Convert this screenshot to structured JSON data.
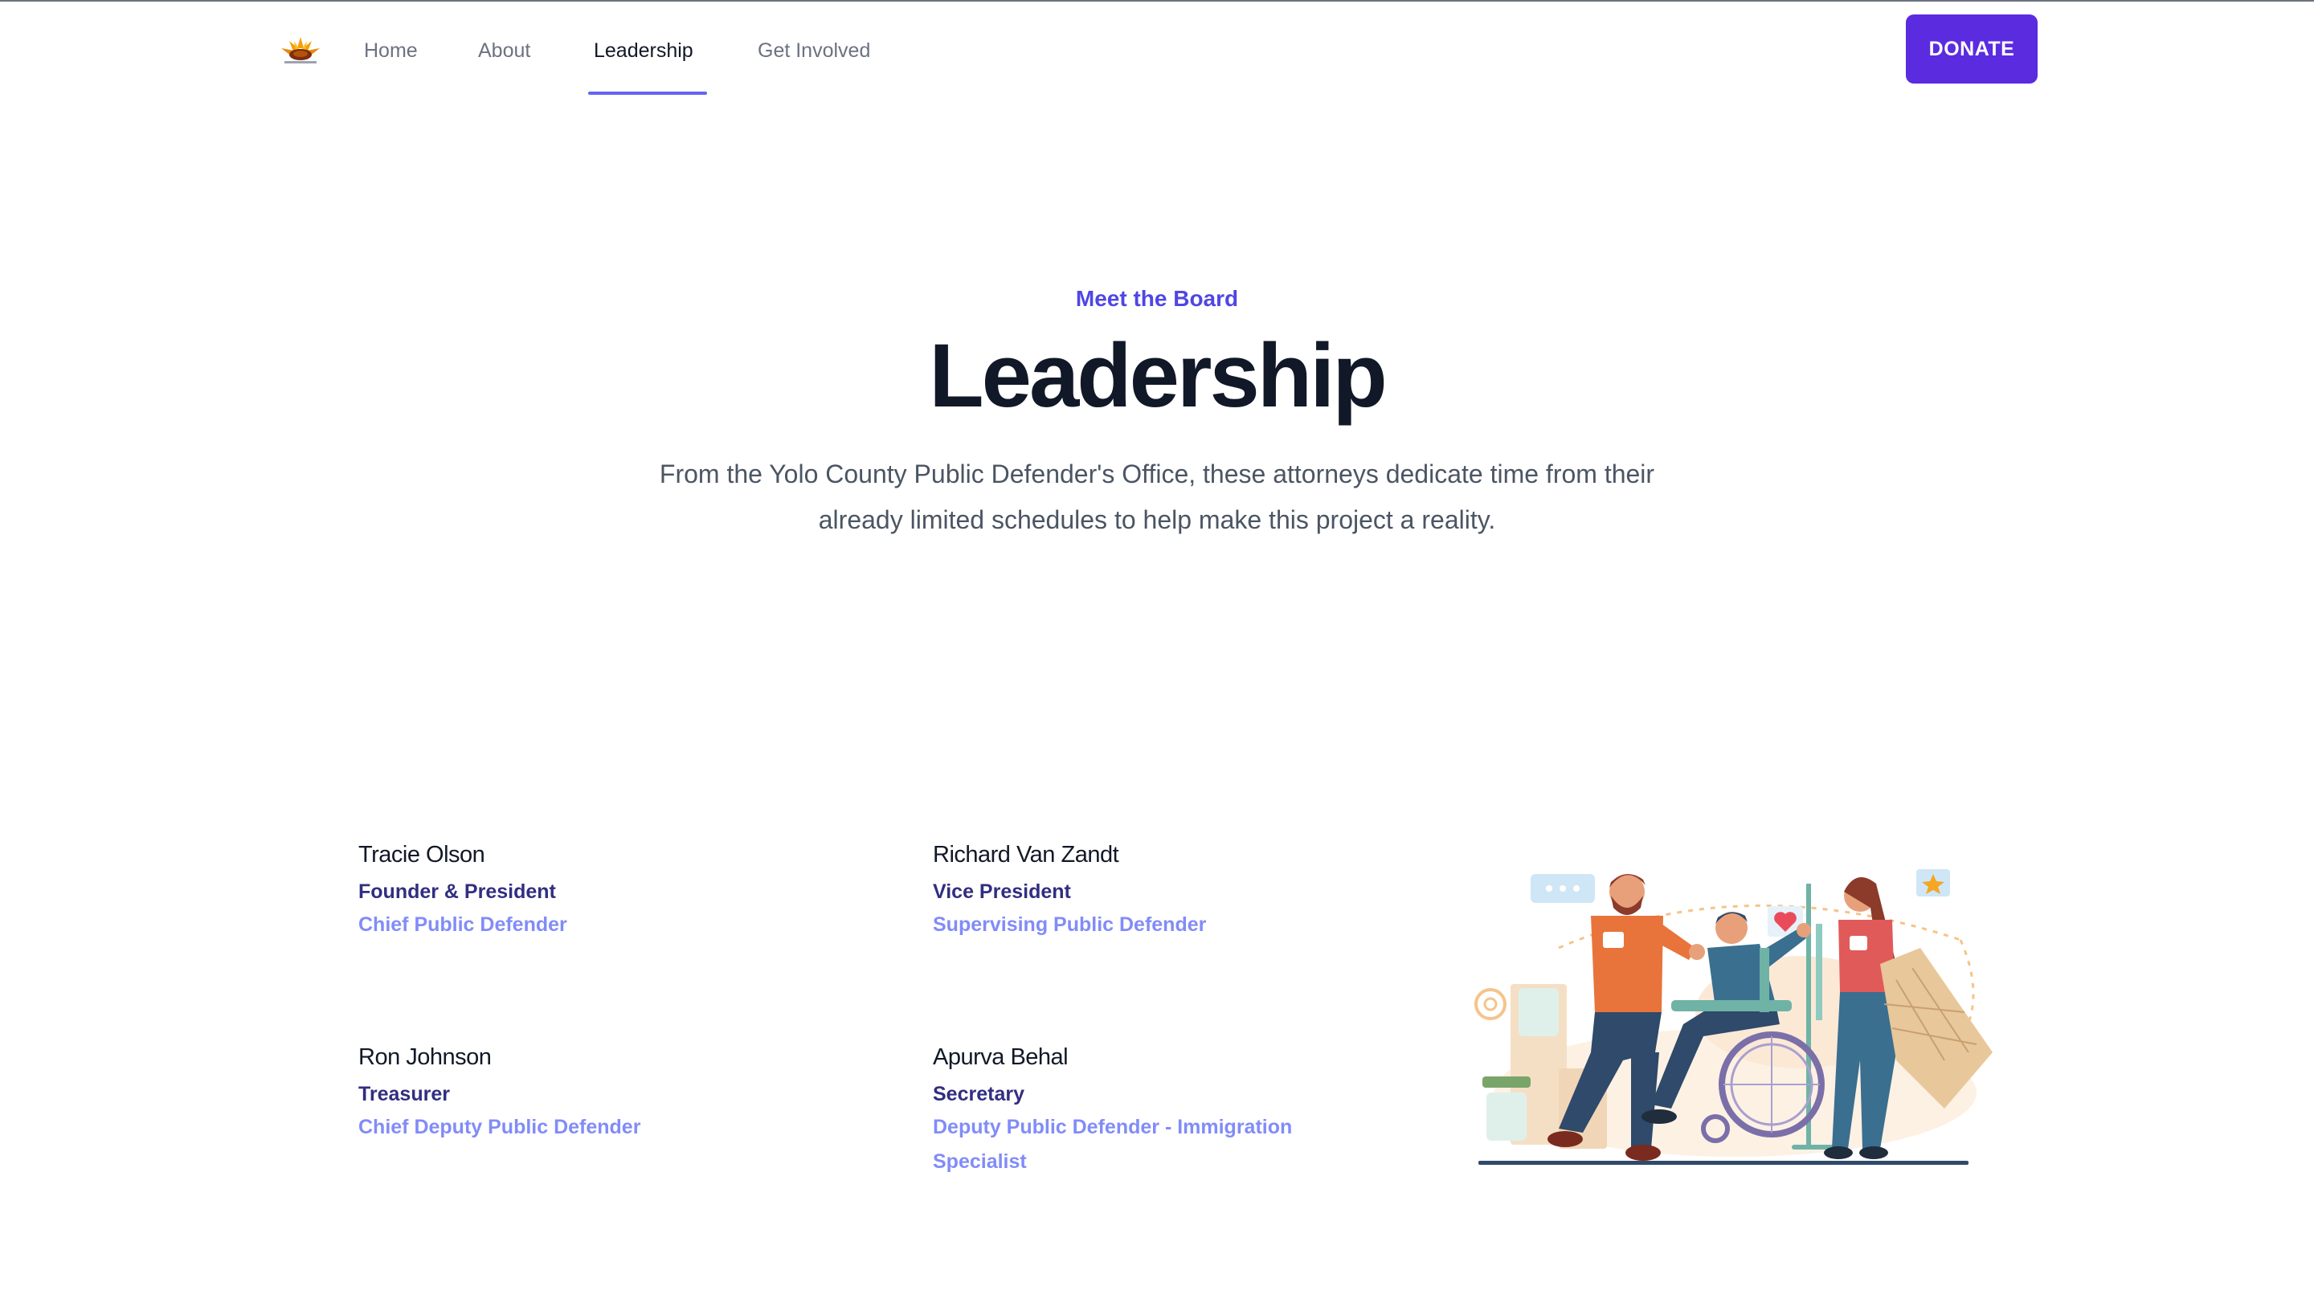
{
  "nav": {
    "links": [
      {
        "label": "Home"
      },
      {
        "label": "About"
      },
      {
        "label": "Leadership"
      },
      {
        "label": "Get Involved"
      }
    ],
    "active": "Leadership",
    "donate_label": "DONATE"
  },
  "hero": {
    "eyebrow": "Meet the Board",
    "title": "Leadership",
    "description": "From the Yolo County Public Defender's Office, these attorneys dedicate time from their already limited schedules to help make this project a reality."
  },
  "board": [
    {
      "name": "Tracie Olson",
      "role": "Founder & President",
      "title": "Chief Public Defender"
    },
    {
      "name": "Richard Van Zandt",
      "role": "Vice President",
      "title": "Supervising Public Defender"
    },
    {
      "name": "Ron Johnson",
      "role": "Treasurer",
      "title": "Chief Deputy Public Defender"
    },
    {
      "name": "Apurva Behal",
      "role": "Secretary",
      "title": "Deputy Public Defender - Immigration Specialist"
    }
  ],
  "colors": {
    "accent": "#4f46e5",
    "donate": "#5b2be0",
    "role": "#312e81",
    "title": "#818cf8"
  },
  "icons": {
    "logo": "sunflower-logo",
    "illustration": "volunteers-illustration"
  }
}
